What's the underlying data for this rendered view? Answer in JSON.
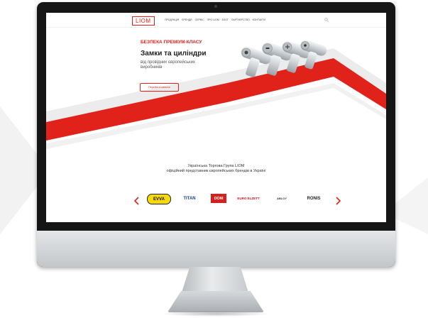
{
  "site": {
    "logo": "LIOM",
    "nav": [
      "ПРОДУКЦІЯ",
      "БРЕНДИ",
      "СЕРВІС",
      "ПРО LIOM",
      "БЛОГ",
      "ПАРТНЕРСТВО",
      "КОНТАКТИ"
    ],
    "hero": {
      "tagline": "БЕЗПЕКА ПРЕМІУМ-КЛАСУ",
      "heading": "Замки та циліндри",
      "subtext": "від провідних європейських виробників",
      "cta": "Перейти в каталог"
    },
    "about": {
      "line1": "Українська Торгова Група LIOM",
      "line2": "офіційний представник європейських брендів в Україні"
    },
    "brands": [
      "EVVA",
      "TITAN",
      "DOM",
      "EURO ELZETT",
      "ABLOY",
      "RONIS"
    ]
  },
  "colors": {
    "accent": "#e0221b",
    "bezel": "#151515",
    "chin": "#d4d6d8"
  },
  "icons": {
    "search": "search-icon",
    "prev": "chevron-left-icon",
    "next": "chevron-right-icon"
  }
}
